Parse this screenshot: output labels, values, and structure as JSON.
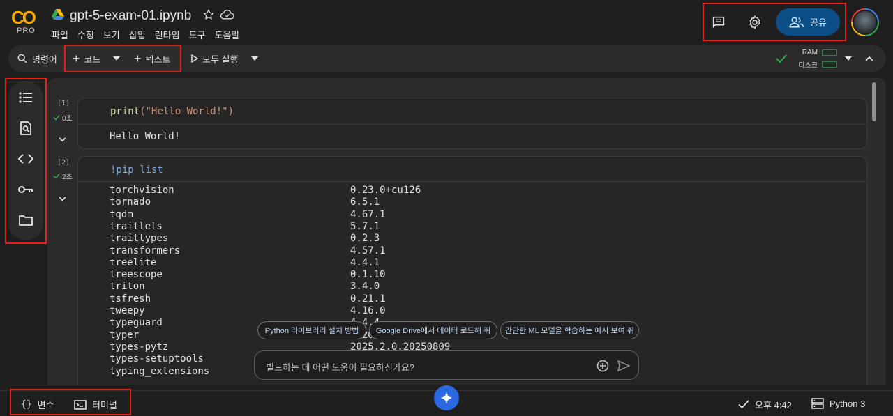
{
  "app": {
    "logo_text": "CO",
    "logo_badge": "PRO",
    "file_name": "gpt-5-exam-01.ipynb"
  },
  "menu": [
    "파일",
    "수정",
    "보기",
    "삽입",
    "런타임",
    "도구",
    "도움말"
  ],
  "header": {
    "share_label": "공유"
  },
  "toolbar": {
    "search_label": "명령어",
    "add_code_label": "코드",
    "add_text_label": "텍스트",
    "run_all_label": "모두 실행",
    "ram_label": "RAM",
    "disk_label": "디스크"
  },
  "cells": [
    {
      "exec_count": "[1]",
      "exec_time": "0초",
      "code": "print(\"Hello World!\")",
      "code_fn": "print",
      "code_arg": "(\"Hello World!\")",
      "output": "Hello World!"
    },
    {
      "exec_count": "[2]",
      "exec_time": "2초",
      "code": "!pip list",
      "packages": [
        [
          "torchvision",
          "0.23.0+cu126"
        ],
        [
          "tornado",
          "6.5.1"
        ],
        [
          "tqdm",
          "4.67.1"
        ],
        [
          "traitlets",
          "5.7.1"
        ],
        [
          "traittypes",
          "0.2.3"
        ],
        [
          "transformers",
          "4.57.1"
        ],
        [
          "treelite",
          "4.4.1"
        ],
        [
          "treescope",
          "0.1.10"
        ],
        [
          "triton",
          "3.4.0"
        ],
        [
          "tsfresh",
          "0.21.1"
        ],
        [
          "tweepy",
          "4.16.0"
        ],
        [
          "typeguard",
          "4.4.4"
        ],
        [
          "typer",
          "0.20.0"
        ],
        [
          "types-pytz",
          "2025.2.0.20250809"
        ],
        [
          "types-setuptools",
          ""
        ],
        [
          "typing_extensions",
          ""
        ]
      ]
    }
  ],
  "suggestions": [
    "Python 라이브러리 설치 방법",
    "Google Drive에서 데이터 로드해 줘",
    "간단한 ML 모델을 학습하는 예시 보여 줘"
  ],
  "prompt": {
    "placeholder": "빌드하는 데 어떤 도움이 필요하신가요?"
  },
  "status": {
    "variables_label": "변수",
    "terminal_label": "터미널",
    "time": "오후 4:42",
    "kernel": "Python 3"
  },
  "colors": {
    "accent": "#0b4f86",
    "logo": "#f9ab00",
    "ok": "#34a853",
    "annotation": "#e8201c"
  }
}
